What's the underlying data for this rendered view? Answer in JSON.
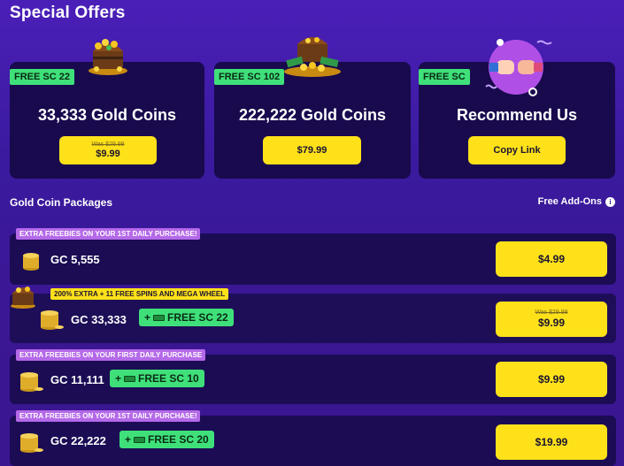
{
  "page": {
    "title": "Special Offers"
  },
  "offers": [
    {
      "badge": "FREE SC 22",
      "name": "33,333 Gold Coins",
      "was": "Was $29.99",
      "price": "$9.99",
      "art_icon": "treasure-chest-icon"
    },
    {
      "badge": "FREE SC 102",
      "name": "222,222 Gold Coins",
      "price": "$79.99",
      "art_icon": "treasure-pile-icon"
    },
    {
      "badge": "FREE SC",
      "name": "Recommend Us",
      "button": "Copy Link",
      "art_icon": "fist-bump-icon"
    }
  ],
  "packages_section": {
    "title": "Gold Coin Packages",
    "addons_label": "Free Add-Ons",
    "info_icon": "i"
  },
  "packages": [
    {
      "tag": "EXTRA FREEBIES ON YOUR 1ST DAILY PURCHASE!",
      "gc": "GC 5,555",
      "price": "$4.99"
    },
    {
      "tag": "200% EXTRA + 11 FREE SPINS AND MEGA WHEEL",
      "gc": "GC 33,333",
      "bonus_plus": "+",
      "bonus": "FREE SC 22",
      "was": "Was $29.99",
      "price": "$9.99"
    },
    {
      "tag": "EXTRA FREEBIES ON YOUR FIRST DAILY PURCHASE",
      "gc": "GC 11,111",
      "bonus_plus": "+",
      "bonus": "FREE SC 10",
      "price": "$9.99"
    },
    {
      "tag": "EXTRA FREEBIES ON YOUR 1ST DAILY PURCHASE!",
      "gc": "GC 22,222",
      "bonus_plus": "+",
      "bonus": "FREE SC 20",
      "price": "$19.99"
    }
  ],
  "colors": {
    "accent_yellow": "#ffe11a",
    "badge_green": "#3fe07a",
    "tag_purple": "#b469e8",
    "card_bg": "#180a4d"
  }
}
